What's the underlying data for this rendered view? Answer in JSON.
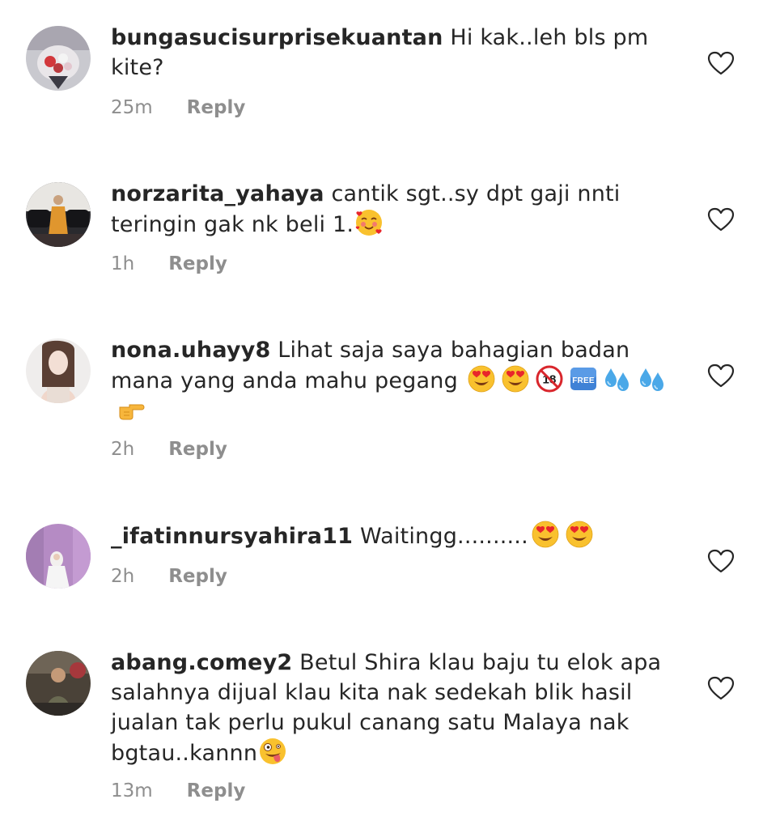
{
  "comments": [
    {
      "username": "bungasucisurprisekuantan",
      "text": "Hi kak..leh bls pm kite?",
      "time": "25m",
      "reply_label": "Reply"
    },
    {
      "username": "norzarita_yahaya",
      "text": "cantik sgt..sy dpt gaji nnti teringin gak nk beli 1.",
      "time": "1h",
      "reply_label": "Reply"
    },
    {
      "username": "nona.uhayy8",
      "text": "Lihat saja saya bahagian badan mana yang anda mahu pegang",
      "time": "2h",
      "reply_label": "Reply"
    },
    {
      "username": "_ifatinnursyahira11",
      "text": "Waitingg..........",
      "time": "2h",
      "reply_label": "Reply"
    },
    {
      "username": "abang.comey2",
      "text": "Betul Shira klau baju tu elok apa salahnya dijual klau kita nak sedekah blik hasil jualan tak perlu pukul canang satu Malaya nak bgtau..kannn",
      "time": "13m",
      "reply_label": "Reply"
    }
  ],
  "icons": {
    "like": "heart-outline-icon",
    "emoji_2": [
      "smiling-face-with-hearts-emoji"
    ],
    "emoji_3": [
      "heart-eyes-emoji",
      "heart-eyes-emoji",
      "no-under-18-emoji",
      "free-button-emoji",
      "sweat-droplets-emoji",
      "sweat-droplets-emoji",
      "pointing-right-emoji"
    ],
    "emoji_4": [
      "heart-eyes-emoji",
      "heart-eyes-emoji"
    ],
    "emoji_5": [
      "zany-face-emoji"
    ]
  },
  "colors": {
    "text": "#262626",
    "meta": "#8e8e8e",
    "background": "#ffffff"
  }
}
